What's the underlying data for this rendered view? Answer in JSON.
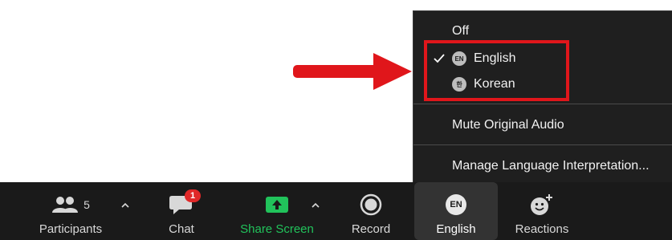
{
  "menu": {
    "items": {
      "off": {
        "label": "Off"
      },
      "english": {
        "label": "English",
        "badge": "EN",
        "checked": true
      },
      "korean": {
        "label": "Korean",
        "badge": "한"
      },
      "mute": {
        "label": "Mute Original Audio"
      },
      "manage": {
        "label": "Manage Language Interpretation..."
      }
    }
  },
  "toolbar": {
    "participants": {
      "label": "Participants",
      "count": "5"
    },
    "chat": {
      "label": "Chat",
      "badge": "1"
    },
    "share": {
      "label": "Share Screen"
    },
    "record": {
      "label": "Record"
    },
    "english": {
      "label": "English",
      "icon_text": "EN"
    },
    "reactions": {
      "label": "Reactions"
    }
  },
  "colors": {
    "toolbar_bg": "#1a1a1a",
    "menu_bg": "#1f1f1f",
    "share_green": "#21c35b",
    "highlight_red": "#e0161b",
    "badge_red": "#e02828"
  },
  "icons": {
    "arrow": "red-arrow-right",
    "participants": "people-icon",
    "chat": "chat-bubble-icon",
    "share": "share-screen-icon",
    "record": "record-icon",
    "reactions": "emoji-plus-icon"
  }
}
